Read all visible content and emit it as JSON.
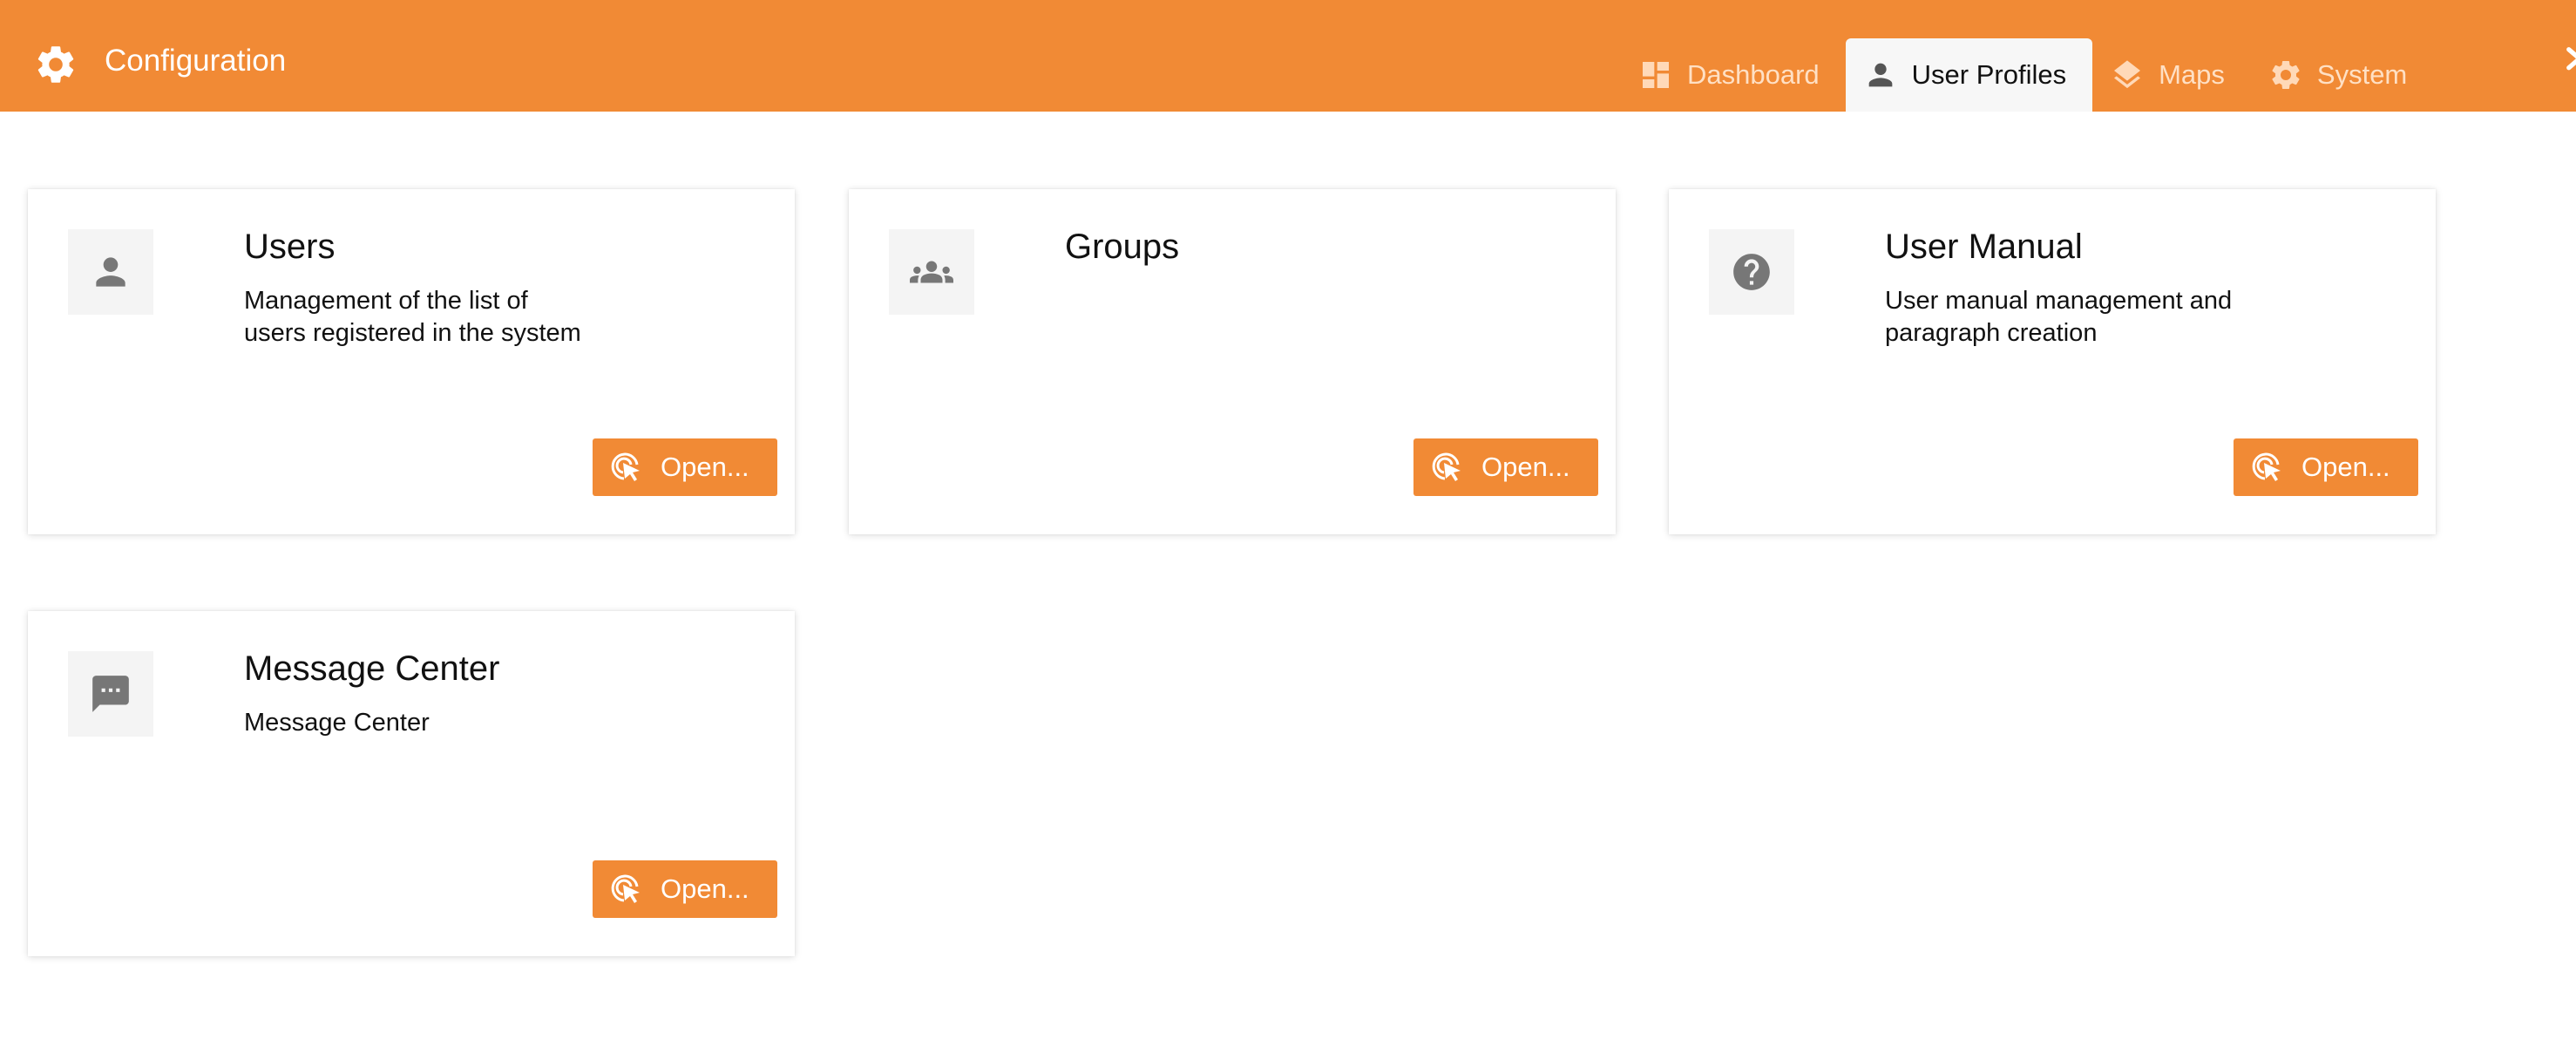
{
  "header": {
    "title": "Configuration",
    "accent_color": "#f18a35",
    "app_icon": "gear-icon",
    "tabs": [
      {
        "label": "Dashboard",
        "icon": "dashboard-icon",
        "active": false
      },
      {
        "label": "User Profiles",
        "icon": "person-icon",
        "active": true
      },
      {
        "label": "Maps",
        "icon": "layers-icon",
        "active": false
      },
      {
        "label": "System",
        "icon": "gear-icon",
        "active": false
      }
    ]
  },
  "cards": [
    {
      "title": "Users",
      "description": "Management of the list of users registered in the system",
      "icon": "person-icon",
      "button_label": "Open..."
    },
    {
      "title": "Groups",
      "description": "",
      "icon": "group-icon",
      "button_label": "Open..."
    },
    {
      "title": "User Manual",
      "description": "User manual management and paragraph creation",
      "icon": "help-icon",
      "button_label": "Open..."
    },
    {
      "title": "Message Center",
      "description": "Message Center",
      "icon": "chat-icon",
      "button_label": "Open..."
    }
  ]
}
